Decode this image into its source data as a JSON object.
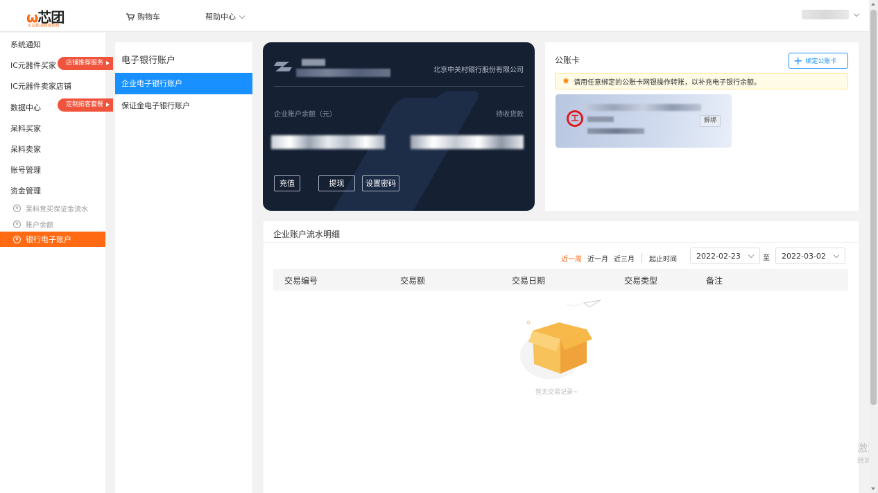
{
  "topbar": {
    "logo_text": "芯团",
    "logo_sub": "IC交易/呆料竞买网",
    "cart_label": "购物车",
    "help_label": "帮助中心"
  },
  "sidebar": {
    "items": [
      {
        "label": "系统通知"
      },
      {
        "label": "IC元器件买家",
        "tag": "店铺推荐服务"
      },
      {
        "label": "IC元器件卖家店铺"
      },
      {
        "label": "数据中心",
        "tag": "定制拓客套餐"
      },
      {
        "label": "呆料买家"
      },
      {
        "label": "呆料卖家"
      },
      {
        "label": "账号管理"
      },
      {
        "label": "资金管理"
      }
    ],
    "sub_items": [
      {
        "label": "呆料竞买保证金流水"
      },
      {
        "label": "账户余额"
      }
    ],
    "active_item": "银行电子账户"
  },
  "bank_nav": {
    "title": "电子银行账户",
    "items": [
      "企业电子银行账户",
      "保证金电子银行账户"
    ]
  },
  "card": {
    "bank_name": "北京中关村银行股份有限公司",
    "balance_label": "企业账户余额（元）",
    "pending_label": "待收货款",
    "buttons": [
      "充值",
      "提现",
      "设置密码"
    ]
  },
  "account": {
    "title": "公账卡",
    "bind_label": "绑定公账卡",
    "notice": "请用任意绑定的公账卡网银操作转账，以补充电子银行余额。",
    "unbind_label": "解绑"
  },
  "transactions": {
    "title": "企业账户流水明细",
    "ranges": [
      "近一周",
      "近一月",
      "近三月"
    ],
    "active_range": "近一周",
    "date_label": "起止时间",
    "start_date": "2022-02-23",
    "to_label": "至",
    "end_date": "2022-03-02",
    "columns": [
      "交易编号",
      "交易额",
      "交易日期",
      "交易类型",
      "备注"
    ],
    "empty_text": "暂无交易记录~"
  },
  "watermark": {
    "line1": "激活",
    "line2": "转到“"
  },
  "colors": {
    "accent": "#ff6a13",
    "primary": "#1890ff",
    "tag_red": "#f0543c"
  }
}
